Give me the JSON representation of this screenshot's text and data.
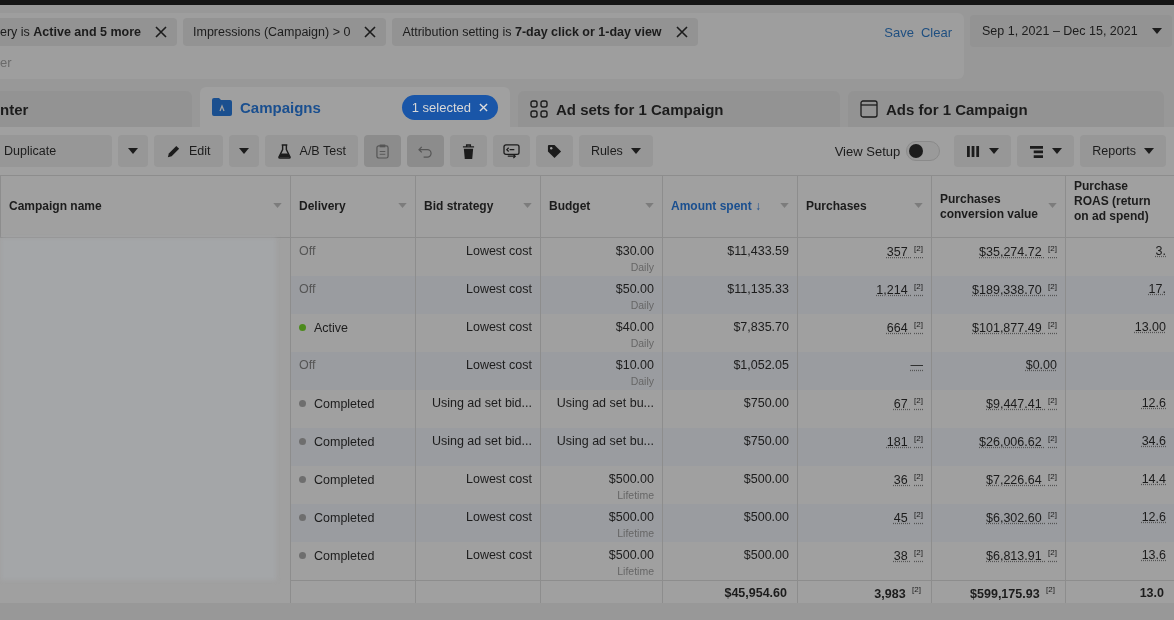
{
  "filters": {
    "chips": [
      {
        "text": "ery is **Active and 5 more**"
      },
      {
        "text": "Impressions (Campaign) > 0"
      },
      {
        "text": "Attribution setting is **7-day click or 1-day view**"
      }
    ],
    "search_placeholder": "er",
    "save": "Save",
    "clear": "Clear"
  },
  "date_range": "Sep 1, 2021 – Dec 15, 2021",
  "tabs": [
    {
      "kind": "plain",
      "label": "nter",
      "selected": false
    },
    {
      "kind": "campaigns",
      "label": "Campaigns",
      "selected": true,
      "badge": "1 selected"
    },
    {
      "kind": "adsets",
      "label": "Ad sets for 1 Campaign",
      "selected": false
    },
    {
      "kind": "ads",
      "label": "Ads for 1 Campaign",
      "selected": false
    }
  ],
  "toolbar": {
    "duplicate": "Duplicate",
    "edit": "Edit",
    "ab_test": "A/B Test",
    "rules": "Rules",
    "view_setup": "View Setup",
    "view_setup_on": false,
    "reports": "Reports"
  },
  "table": {
    "columns": [
      {
        "label": "Campaign name",
        "sorted": false
      },
      {
        "label": "Delivery",
        "sorted": false
      },
      {
        "label": "Bid strategy",
        "sorted": false
      },
      {
        "label": "Budget",
        "sorted": false
      },
      {
        "label": "Amount spent ↓",
        "sorted": true
      },
      {
        "label": "Purchases",
        "sorted": false
      },
      {
        "label": "Purchases conversion value",
        "sorted": false
      },
      {
        "label": "Purchase ROAS (return on ad spend)",
        "sorted": false
      }
    ],
    "rows": [
      {
        "delivery": "Off",
        "dot": false,
        "bid": "Lowest cost",
        "budget": "$30.00",
        "budget_period": "Daily",
        "spent": "$11,433.59",
        "purchases": "357 $^{[2]}$",
        "value": "$35,274.72 $^{[2]}$",
        "roas": "3."
      },
      {
        "delivery": "Off",
        "dot": false,
        "bid": "Lowest cost",
        "budget": "$50.00",
        "budget_period": "Daily",
        "spent": "$11,135.33",
        "purchases": "1,214 $^{[2]}$",
        "value": "$189,338.70 $^{[2]}$",
        "roas": "17."
      },
      {
        "delivery": "Active",
        "dot": true,
        "color": "#4c8a1c",
        "bid": "Lowest cost",
        "budget": "$40.00",
        "budget_period": "Daily",
        "spent": "$7,835.70",
        "purchases": "664 $^{[2]}$",
        "value": "$101,877.49 $^{[2]}$",
        "roas": "13.00"
      },
      {
        "delivery": "Off",
        "dot": false,
        "bid": "Lowest cost",
        "budget": "$10.00",
        "budget_period": "Daily",
        "spent": "$1,052.05",
        "purchases": "—",
        "value": "$0.00"
      },
      {
        "delivery": "Completed",
        "dot": true,
        "color": "#6e6e6e",
        "bid": "Using ad set bid...",
        "budget": "Using ad set bu...",
        "spent": "$750.00",
        "purchases": "67 $^{[2]}$",
        "value": "$9,447.41 $^{[2]}$",
        "roas": "12.6"
      },
      {
        "delivery": "Completed",
        "dot": true,
        "color": "#6e6e6e",
        "bid": "Using ad set bid...",
        "budget": "Using ad set bu...",
        "spent": "$750.00",
        "purchases": "181 $^{[2]}$",
        "value": "$26,006.62 $^{[2]}$",
        "roas": "34.6"
      },
      {
        "delivery": "Completed",
        "dot": true,
        "color": "#6e6e6e",
        "bid": "Lowest cost",
        "budget": "$500.00",
        "budget_period": "Lifetime",
        "spent": "$500.00",
        "purchases": "36 $^{[2]}$",
        "value": "$7,226.64 $^{[2]}$",
        "roas": "14.4"
      },
      {
        "delivery": "Completed",
        "dot": true,
        "color": "#6e6e6e",
        "bid": "Lowest cost",
        "budget": "$500.00",
        "budget_period": "Lifetime",
        "spent": "$500.00",
        "purchases": "45 $^{[2]}$",
        "value": "$6,302.60 $^{[2]}$",
        "roas": "12.6"
      },
      {
        "delivery": "Completed",
        "dot": true,
        "color": "#6e6e6e",
        "bid": "Lowest cost",
        "budget": "$500.00",
        "budget_period": "Lifetime",
        "spent": "$500.00",
        "purchases": "38 $^{[2]}$",
        "value": "$6,813.91 $^{[2]}$",
        "roas": "13.6"
      }
    ],
    "totals": {
      "spent": "$45,954.60",
      "purchases": "3,983 $^{[2]}$",
      "value": "$599,175.93 $^{[2]}$",
      "roas": "13.0"
    }
  }
}
